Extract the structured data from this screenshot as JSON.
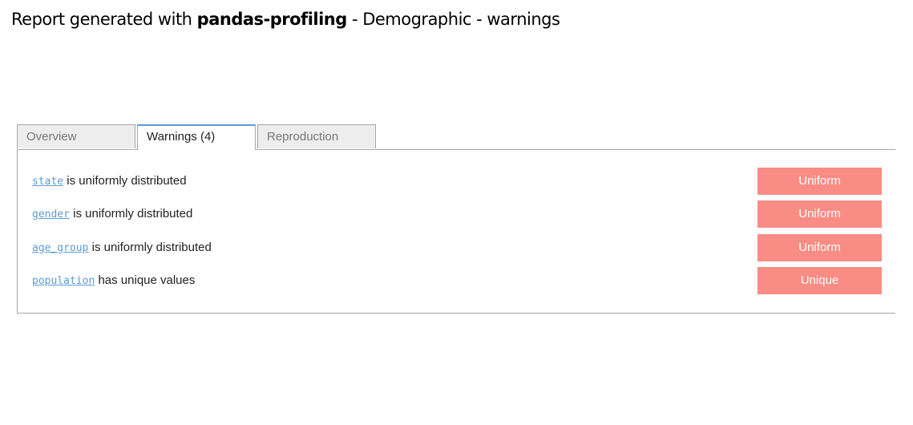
{
  "header": {
    "prefix": "Report generated with ",
    "brand": "pandas-profiling",
    "suffix": " - Demographic - warnings"
  },
  "tabs": [
    {
      "label": "Overview",
      "active": false
    },
    {
      "label": "Warnings (4)",
      "active": true
    },
    {
      "label": "Reproduction",
      "active": false
    }
  ],
  "warnings": [
    {
      "variable": "state",
      "message": " is uniformly distributed",
      "badge": "Uniform"
    },
    {
      "variable": "gender",
      "message": " is uniformly distributed",
      "badge": "Uniform"
    },
    {
      "variable": "age_group",
      "message": " is uniformly distributed",
      "badge": "Uniform"
    },
    {
      "variable": "population",
      "message": " has unique values",
      "badge": "Unique"
    }
  ],
  "colors": {
    "accent": "#5b9bd5",
    "badge": "#f98c84",
    "tab_border": "#a6a6a6"
  }
}
